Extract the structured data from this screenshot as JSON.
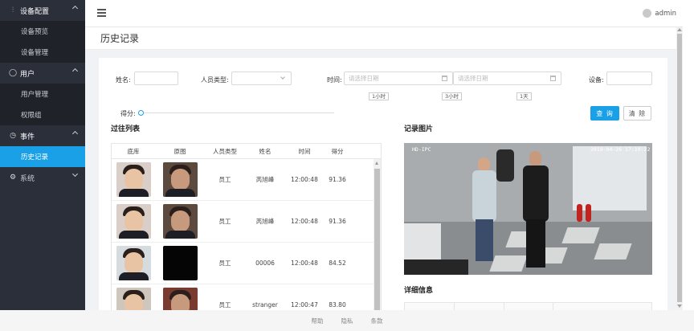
{
  "sidebar": {
    "groups": [
      {
        "icon": "sliders-icon",
        "label": "设备配置",
        "expanded": true,
        "items": [
          {
            "label": "设备预览"
          },
          {
            "label": "设备管理"
          }
        ]
      },
      {
        "icon": "user-icon",
        "label": "用户",
        "expanded": true,
        "items": [
          {
            "label": "用户管理"
          },
          {
            "label": "权限组"
          }
        ]
      },
      {
        "icon": "clock-icon",
        "label": "事件",
        "expanded": true,
        "items": [
          {
            "label": "历史记录",
            "active": true
          }
        ]
      },
      {
        "icon": "gear-icon",
        "label": "系统",
        "expanded": false,
        "items": []
      }
    ]
  },
  "header": {
    "username": "admin"
  },
  "page": {
    "title": "历史记录"
  },
  "filters": {
    "name_label": "姓名:",
    "person_type_label": "人员类型:",
    "time_label": "时间:",
    "start_placeholder": "请选择日期",
    "end_placeholder": "请选择日期",
    "device_label": "设备:",
    "quick_ranges": [
      "1小时",
      "3小时",
      "1天"
    ],
    "score_label": "得分:",
    "query_button": "查 询",
    "clear_button": "清 除"
  },
  "history_list": {
    "title": "过往列表",
    "columns": [
      "底库",
      "原图",
      "人员类型",
      "姓名",
      "时间",
      "得分"
    ],
    "rows": [
      {
        "type": "员工",
        "name": "芮旭峰",
        "time": "12:00:48",
        "score": "91.36"
      },
      {
        "type": "员工",
        "name": "芮旭峰",
        "time": "12:00:48",
        "score": "91.36"
      },
      {
        "type": "员工",
        "name": "00006",
        "time": "12:00:48",
        "score": "84.52"
      },
      {
        "type": "员工",
        "name": "stranger",
        "time": "12:00:47",
        "score": "83.80"
      }
    ]
  },
  "record_image": {
    "title": "记录图片",
    "camera_label": "HD-IPC",
    "timestamp": "2019-04-26 17:19:22"
  },
  "detail": {
    "title": "详细信息"
  },
  "footer": {
    "links": [
      "帮助",
      "隐私",
      "条款"
    ]
  },
  "colors": {
    "accent": "#1aa0e6",
    "sidebar_bg": "#2b2f3a"
  }
}
